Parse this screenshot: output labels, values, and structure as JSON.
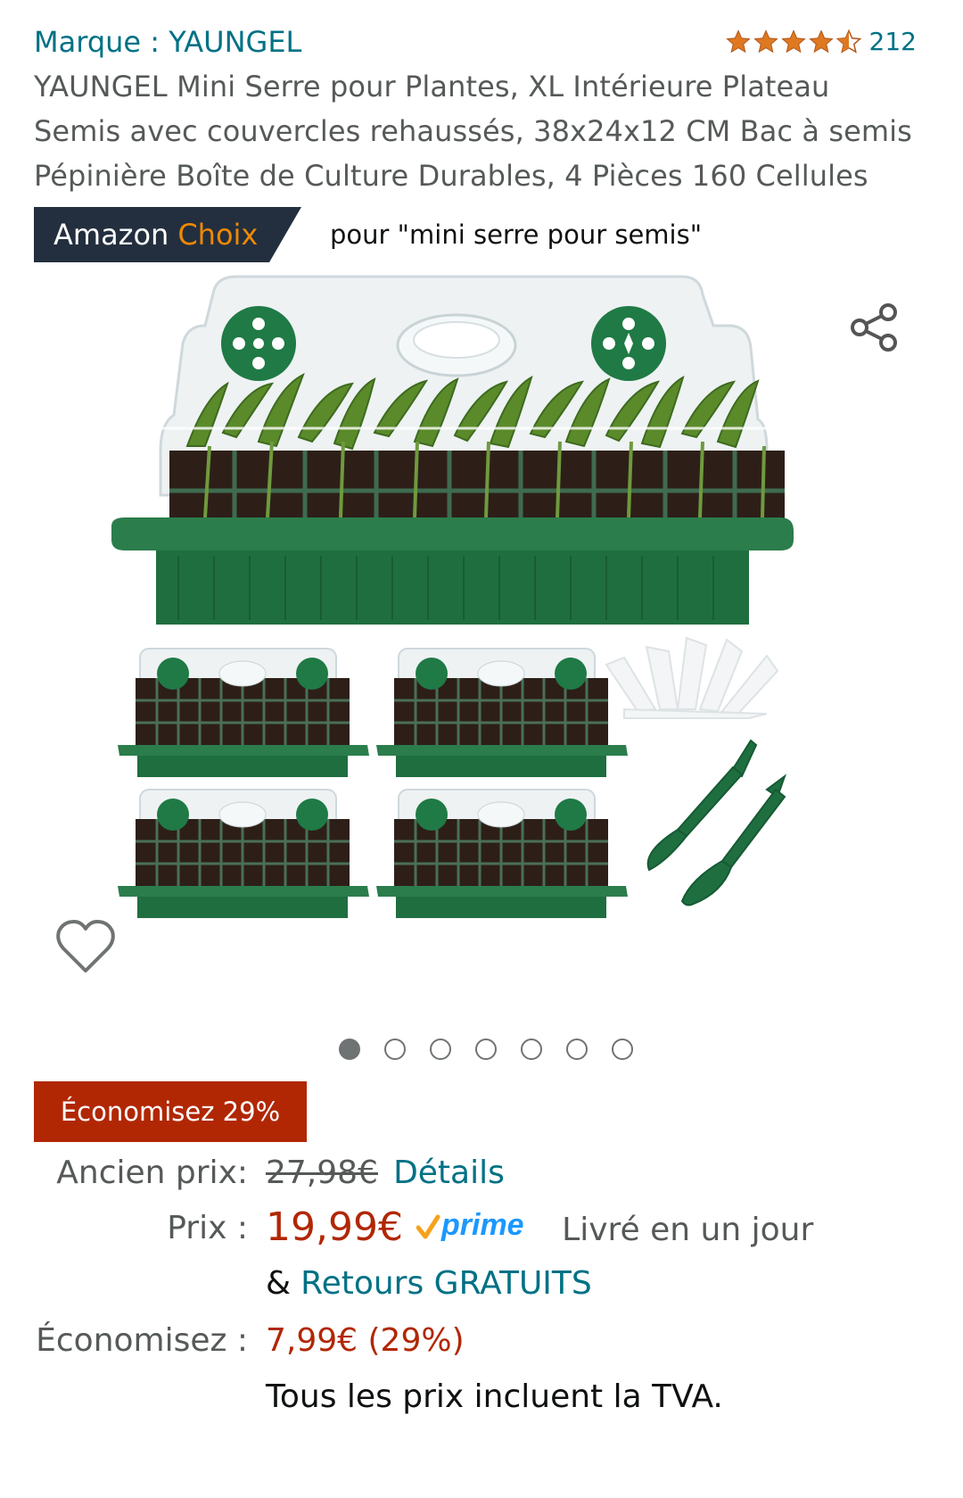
{
  "brand": {
    "label": "Marque : YAUNGEL"
  },
  "rating": {
    "stars": 4.5,
    "count": "212",
    "star_color": "#de7921"
  },
  "product_title": "YAUNGEL Mini Serre pour Plantes, XL Intérieure Plateau Semis avec couvercles rehaussés, 38x24x12 CM Bac à semis Pépinière Boîte de Culture Durables, 4 Pièces 160 Cellules",
  "amazon_choice": {
    "badge_prefix": "Amazon",
    "badge_highlight": "Choix",
    "query": "pour \"mini serre pour semis\""
  },
  "gallery": {
    "image_count": 7,
    "active_index": 0,
    "icons": [
      "share-icon",
      "heart-icon"
    ]
  },
  "savings_badge": "Économisez 29%",
  "pricing": {
    "old_price_label": "Ancien prix:",
    "old_price": "27,98€",
    "details_link": "Détails",
    "price_label": "Prix :",
    "price": "19,99€",
    "prime_label": "prime",
    "delivery": "Livré en un jour",
    "returns_amp": "&",
    "returns_link": "Retours GRATUITS",
    "savings_label": "Économisez :",
    "savings_value": "7,99€ (29%)",
    "tax_note": "Tous les prix incluent la TVA."
  },
  "colors": {
    "link": "#007185",
    "price_red": "#b12704",
    "badge_dark": "#232f3e",
    "choice_orange": "#f08804",
    "prime_blue": "#1a98ff"
  }
}
